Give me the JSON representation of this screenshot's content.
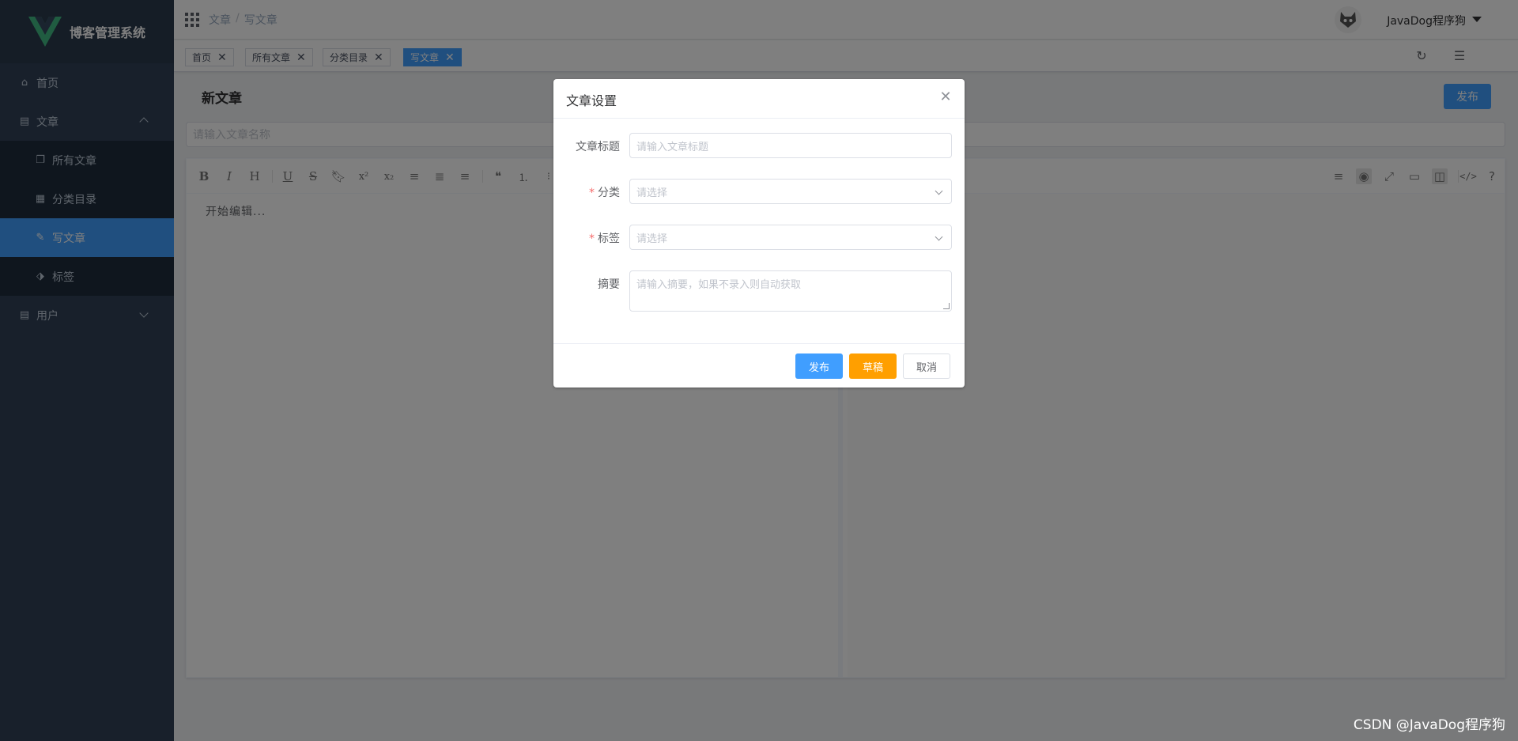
{
  "app": {
    "title": "博客管理系统"
  },
  "sidebar": {
    "items": [
      {
        "label": "首页",
        "icon": "home-icon"
      },
      {
        "label": "文章",
        "icon": "book-icon"
      },
      {
        "label": "所有文章",
        "icon": "copy-icon"
      },
      {
        "label": "分类目录",
        "icon": "table-icon"
      },
      {
        "label": "写文章",
        "icon": "pencil-icon"
      },
      {
        "label": "标签",
        "icon": "tag-icon"
      },
      {
        "label": "用户",
        "icon": "book-icon"
      }
    ]
  },
  "navbar": {
    "breadcrumb": [
      "文章",
      "写文章"
    ],
    "breadcrumb_sep": "/",
    "username": "JavaDog程序狗"
  },
  "tags": [
    "首页",
    "所有文章",
    "分类目录",
    "写文章"
  ],
  "main": {
    "page_title": "新文章",
    "publish_label": "发布",
    "title_placeholder": "请输入文章名称",
    "editor_placeholder": "开始编辑..."
  },
  "editor_toolbar": {
    "left": [
      "B",
      "I",
      "H",
      "U",
      "S",
      "bookmark",
      "x²",
      "x₂",
      "align-left",
      "align-center",
      "align-right",
      "quote",
      "ol",
      "ul"
    ],
    "right": [
      "menu",
      "eye",
      "fullscreen",
      "window",
      "columns",
      "code",
      "help"
    ]
  },
  "dialog": {
    "title": "文章设置",
    "fields": {
      "title": {
        "label": "文章标题",
        "placeholder": "请输入文章标题"
      },
      "category": {
        "label": "分类",
        "placeholder": "请选择",
        "required": true
      },
      "tags": {
        "label": "标签",
        "placeholder": "请选择",
        "required": true
      },
      "summary": {
        "label": "摘要",
        "placeholder": "请输入摘要，如果不录入则自动获取"
      }
    },
    "required_mark": "*",
    "buttons": {
      "publish": "发布",
      "draft": "草稿",
      "cancel": "取消"
    }
  },
  "watermark": "CSDN @JavaDog程序狗",
  "colors": {
    "primary": "#409eff",
    "warning": "#ff9f00",
    "sidebar": "#304156",
    "danger": "#f56c6c"
  }
}
